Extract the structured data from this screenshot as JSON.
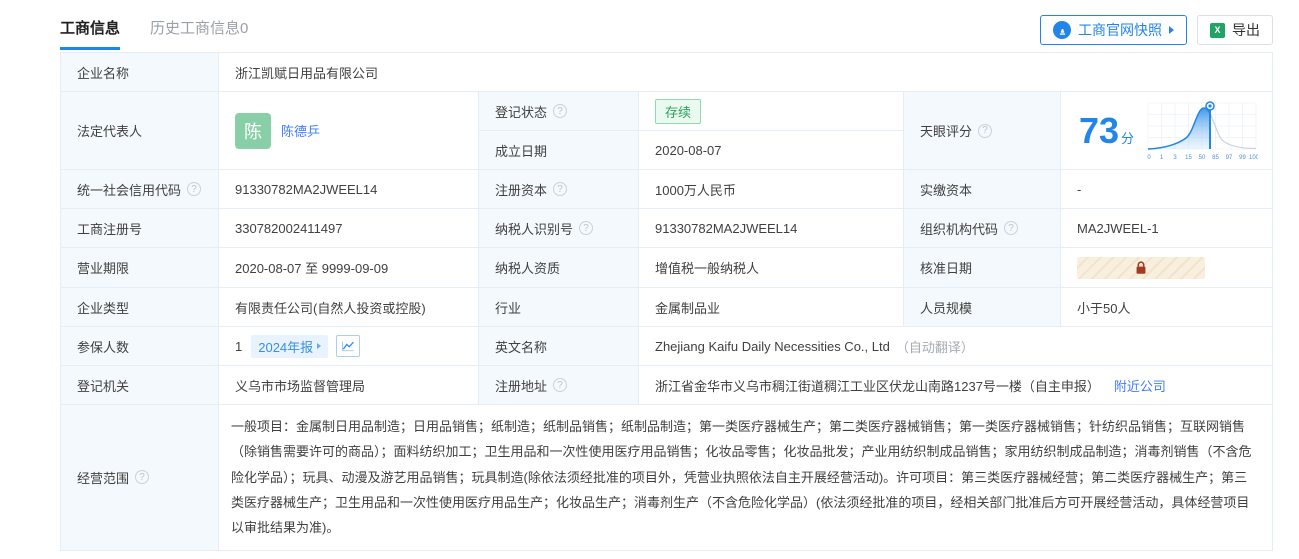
{
  "tabs": [
    {
      "label": "工商信息"
    },
    {
      "label": "历史工商信息0"
    }
  ],
  "toolbar": {
    "snapshot": "工商官网快照",
    "export": "导出"
  },
  "fields": {
    "company_name": {
      "label": "企业名称",
      "value": "浙江凯赋日用品有限公司"
    },
    "legal_rep": {
      "label": "法定代表人",
      "avatar_text": "陈",
      "name": "陈德乒"
    },
    "reg_status": {
      "label": "登记状态",
      "value": "存续"
    },
    "establish_date": {
      "label": "成立日期",
      "value": "2020-08-07"
    },
    "tianyan_score": {
      "label": "天眼评分",
      "value": "73",
      "unit": "分"
    },
    "credit_code": {
      "label": "统一社会信用代码",
      "value": "91330782MA2JWEEL14"
    },
    "reg_capital": {
      "label": "注册资本",
      "value": "1000万人民币"
    },
    "paid_capital": {
      "label": "实缴资本",
      "value": "-"
    },
    "reg_number": {
      "label": "工商注册号",
      "value": "330782002411497"
    },
    "taxpayer_id": {
      "label": "纳税人识别号",
      "value": "91330782MA2JWEEL14"
    },
    "org_code": {
      "label": "组织机构代码",
      "value": "MA2JWEEL-1"
    },
    "business_term": {
      "label": "营业期限",
      "value": "2020-08-07 至 9999-09-09"
    },
    "taxpayer_quality": {
      "label": "纳税人资质",
      "value": "增值税一般纳税人"
    },
    "approval_date": {
      "label": "核准日期"
    },
    "company_type": {
      "label": "企业类型",
      "value": "有限责任公司(自然人投资或控股)"
    },
    "industry": {
      "label": "行业",
      "value": "金属制品业"
    },
    "staff_size": {
      "label": "人员规模",
      "value": "小于50人"
    },
    "insured_count": {
      "label": "参保人数",
      "value": "1",
      "report_badge": "2024年报"
    },
    "english_name": {
      "label": "英文名称",
      "value": "Zhejiang Kaifu Daily Necessities Co., Ltd",
      "note": "（自动翻译）"
    },
    "reg_authority": {
      "label": "登记机关",
      "value": "义乌市市场监督管理局"
    },
    "reg_address": {
      "label": "注册地址",
      "value": "浙江省金华市义乌市稠江街道稠江工业区伏龙山南路1237号一楼（自主申报）",
      "link": "附近公司"
    },
    "business_scope": {
      "label": "经营范围",
      "value": "一般项目：金属制日用品制造；日用品销售；纸制造；纸制品销售；纸制品制造；第一类医疗器械生产；第二类医疗器械销售；第一类医疗器械销售；针纺织品销售；互联网销售（除销售需要许可的商品）；面料纺织加工；卫生用品和一次性使用医疗用品销售；化妆品零售；化妆品批发；产业用纺织制成品销售；家用纺织制成品制造；消毒剂销售（不含危险化学品）；玩具、动漫及游艺用品销售；玩具制造(除依法须经批准的项目外，凭营业执照依法自主开展经营活动)。许可项目：第三类医疗器械经营；第二类医疗器械生产；第三类医疗器械生产；卫生用品和一次性使用医疗用品生产；化妆品生产；消毒剂生产（不含危险化学品）(依法须经批准的项目，经相关部门批准后方可开展经营活动，具体经营项目以审批结果为准)。"
    }
  },
  "score_chart": {
    "type": "area",
    "score": 73,
    "ticks": [
      "0",
      "1",
      "3",
      "15",
      "50",
      "85",
      "97",
      "99",
      "100"
    ]
  },
  "colors": {
    "accent_blue": "#2286e8",
    "link_blue": "#3e7bfa",
    "status_green": "#2ba05a",
    "label_bg": "#f3f9fd",
    "border": "#e6eef5",
    "lock_red": "#a33b1f"
  }
}
